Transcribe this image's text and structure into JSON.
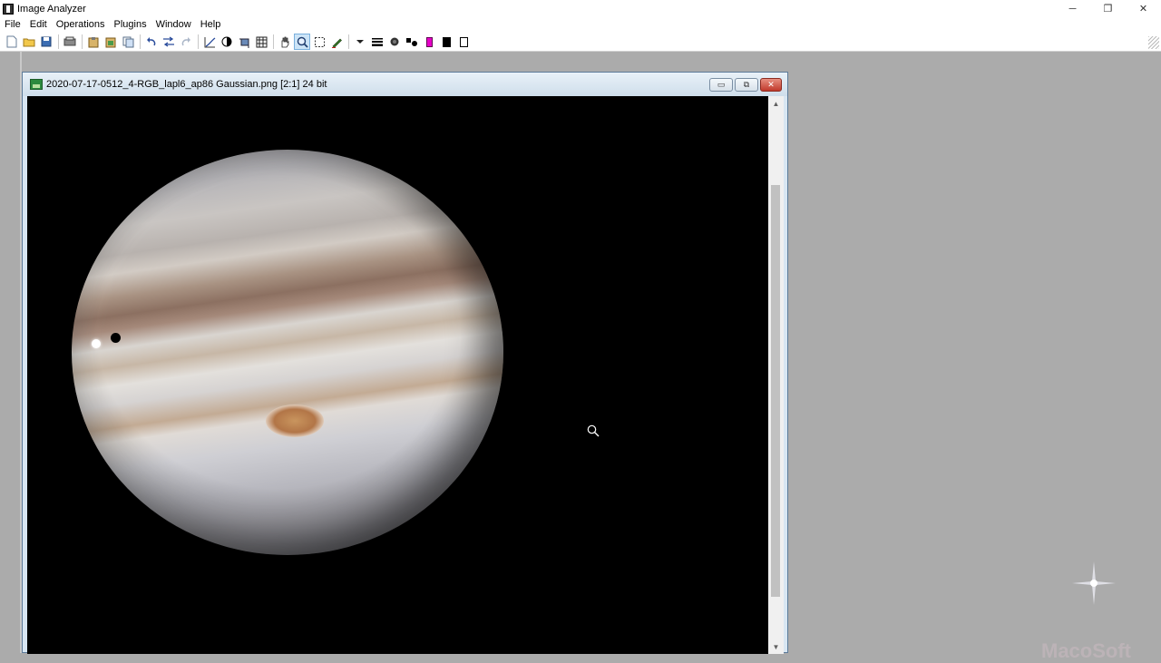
{
  "app": {
    "title": "Image Analyzer",
    "controls": {
      "minimize": "─",
      "restore": "❐",
      "close": "✕"
    }
  },
  "menu": [
    "File",
    "Edit",
    "Operations",
    "Plugins",
    "Window",
    "Help"
  ],
  "toolbar": {
    "groups": [
      [
        "new-icon",
        "open-icon",
        "save-icon"
      ],
      [
        "scan-icon"
      ],
      [
        "paste-icon",
        "paste-special-icon",
        "copy-icon"
      ],
      [
        "undo-icon",
        "swap-icon",
        "redo-icon"
      ],
      [
        "curve-icon",
        "contrast-icon",
        "crop-icon",
        "grid-icon"
      ],
      [
        "hand-icon",
        "zoom-icon",
        "select-icon",
        "pen-icon"
      ],
      [
        "dropdown-icon",
        "line-width-icon",
        "dot-icon",
        "shapes-icon",
        "magenta-swatch-icon",
        "black-swatch-icon",
        "white-swatch-icon"
      ]
    ],
    "active": "zoom-icon",
    "magenta": "#e600c8"
  },
  "child_window": {
    "caption": "2020-07-17-0512_4-RGB_lapl6_ap86 Gaussian.png [2:1] 24 bit",
    "controls": {
      "minimize": "▭",
      "maximize": "⧉",
      "close": "✕"
    }
  },
  "watermark": "MacoSoft"
}
